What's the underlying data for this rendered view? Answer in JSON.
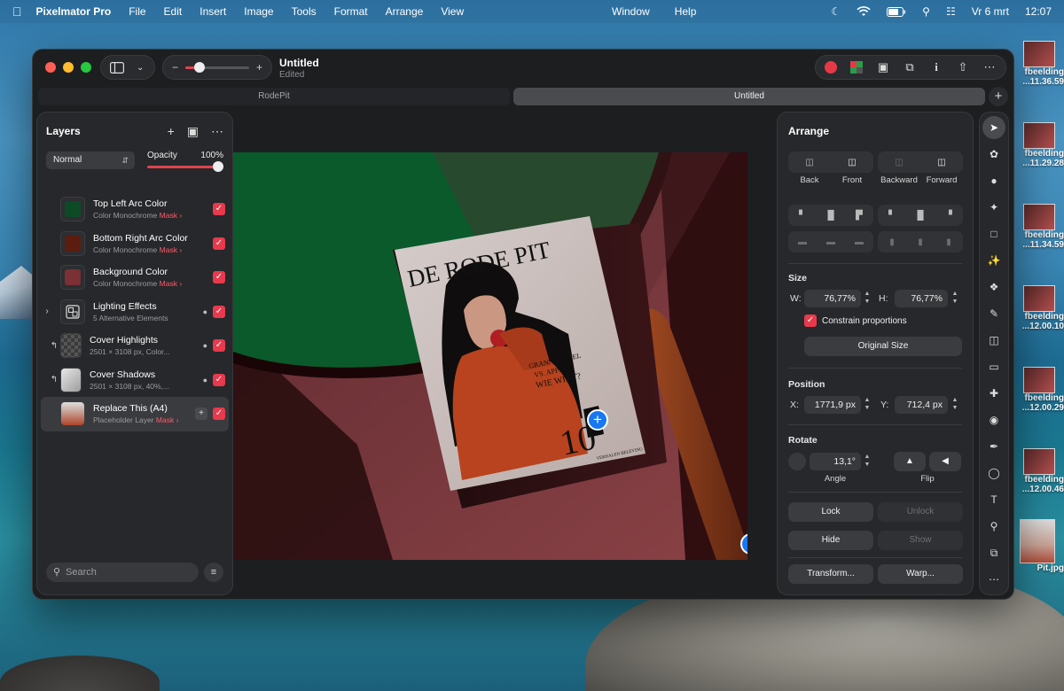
{
  "menubar": {
    "app": "Pixelmator Pro",
    "items": [
      "File",
      "Edit",
      "Insert",
      "Image",
      "Tools",
      "Format",
      "Arrange",
      "View"
    ],
    "center_items": [
      "Window",
      "Help"
    ],
    "date": "Vr 6 mrt",
    "time": "12:07"
  },
  "desktop": {
    "icons": [
      {
        "l1": "fbeelding",
        "l2": "...11.36.59"
      },
      {
        "l1": "fbeelding",
        "l2": "...11.29.28"
      },
      {
        "l1": "fbeelding",
        "l2": "...11.34.59"
      },
      {
        "l1": "fbeelding",
        "l2": "...12.00.10"
      },
      {
        "l1": "fbeelding",
        "l2": "...12.00.29"
      },
      {
        "l1": "fbeelding",
        "l2": "...12.00.46"
      },
      {
        "l1": "Pit.jpg",
        "l2": ""
      }
    ]
  },
  "window": {
    "title": "Untitled",
    "subtitle": "Edited",
    "tabs": [
      "RodePit",
      "Untitled"
    ],
    "zoom_level": 0.22
  },
  "layers": {
    "title": "Layers",
    "blend_mode": "Normal",
    "opacity_label": "Opacity",
    "opacity_value": "100%",
    "items": [
      {
        "name": "Top Left Arc Color",
        "sub": "Color Monochrome",
        "mask": "Mask",
        "color": "#0d4a26"
      },
      {
        "name": "Bottom Right Arc Color",
        "sub": "Color Monochrome",
        "mask": "Mask",
        "color": "#5a1d10"
      },
      {
        "name": "Background Color",
        "sub": "Color Monochrome",
        "mask": "Mask",
        "color": "#7a3035"
      },
      {
        "name": "Lighting Effects",
        "sub": "5 Alternative Elements"
      },
      {
        "name": "Cover Highlights",
        "sub": "2501 × 3108 px, Color..."
      },
      {
        "name": "Cover Shadows",
        "sub": "2501 × 3108 px, 40%,..."
      },
      {
        "name": "Replace This (A4)",
        "sub": "Placeholder Layer",
        "mask": "Mask"
      }
    ],
    "search_placeholder": "Search"
  },
  "magazine": {
    "title": "DE RODE PIT",
    "tag1": "GRANNY APPEL",
    "tag2": "VS. APPEL",
    "tag3": "WIE WINT?",
    "number": "10",
    "small_text": "VERHALEN BELEVING"
  },
  "arrange": {
    "title": "Arrange",
    "order_buttons": [
      "Back",
      "Front",
      "Backward",
      "Forward"
    ],
    "size_title": "Size",
    "w_label": "W:",
    "w_value": "76,77%",
    "h_label": "H:",
    "h_value": "76,77%",
    "constrain_label": "Constrain proportions",
    "original_size": "Original Size",
    "position_title": "Position",
    "x_label": "X:",
    "x_value": "1771,9 px",
    "y_label": "Y:",
    "y_value": "712,4 px",
    "rotate_title": "Rotate",
    "angle_value": "13,1°",
    "angle_label": "Angle",
    "flip_label": "Flip",
    "lock": "Lock",
    "unlock": "Unlock",
    "hide": "Hide",
    "show": "Show",
    "transform": "Transform...",
    "warp": "Warp..."
  },
  "colors": {
    "accent": "#e8394d",
    "arc_green": "#0b5a2c",
    "background_pink": "#7e3a3f",
    "dark_red": "#2c0f11",
    "wedge": "#8a3f1d"
  }
}
